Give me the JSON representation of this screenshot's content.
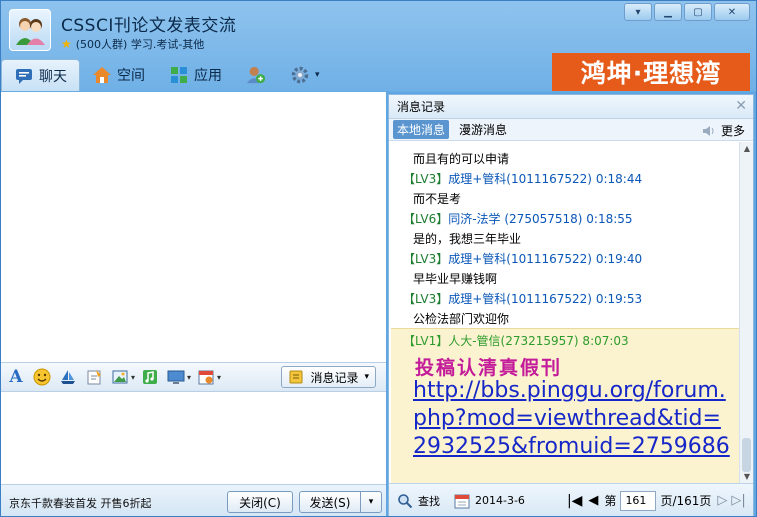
{
  "window": {
    "title": "CSSCI刊论文发表交流",
    "subtitle": "(500人群) 学习.考试-其他"
  },
  "tabs": [
    {
      "label": "聊天",
      "icon": "chat-icon"
    },
    {
      "label": "空间",
      "icon": "house-icon"
    },
    {
      "label": "应用",
      "icon": "apps-icon"
    }
  ],
  "ad_banner": "鸿坤·理想湾",
  "input_toolbar": {
    "history_label": "消息记录"
  },
  "bottom_bar": {
    "ad_text": "京东千款春装首发 开售6折起",
    "close_label": "关闭(C)",
    "send_label": "发送(S)"
  },
  "history_panel": {
    "title": "消息记录",
    "tab_local": "本地消息",
    "tab_roaming": "漫游消息",
    "more_label": "更多",
    "messages": [
      {
        "kind": "text",
        "text": "而且有的可以申请"
      },
      {
        "kind": "sender",
        "lv": "【LV3】",
        "name": "成理+管科(1011167522)",
        "time": "0:18:44"
      },
      {
        "kind": "text",
        "text": "而不是考"
      },
      {
        "kind": "sender",
        "lv": "【LV6】",
        "name": "同济-法学 (275057518)",
        "time": "0:18:55"
      },
      {
        "kind": "text",
        "text": "是的，我想三年毕业"
      },
      {
        "kind": "sender",
        "lv": "【LV3】",
        "name": "成理+管科(1011167522)",
        "time": "0:19:40"
      },
      {
        "kind": "text",
        "text": "早毕业早赚钱啊"
      },
      {
        "kind": "sender",
        "lv": "【LV3】",
        "name": "成理+管科(1011167522)",
        "time": "0:19:53"
      },
      {
        "kind": "text",
        "text": "公检法部门欢迎你"
      }
    ],
    "highlight": {
      "sender": "【LV1】人大-管信(273215957) 8:07:03",
      "title": "投稿认清真假刊",
      "url": "http://bbs.pinggu.org/forum.php?mod=viewthread&tid=2932525&fromuid=2759686"
    },
    "footer": {
      "search_label": "查找",
      "date": "2014-3-6",
      "page_prefix": "第",
      "page_value": "161",
      "page_suffix": "页/161页"
    }
  }
}
